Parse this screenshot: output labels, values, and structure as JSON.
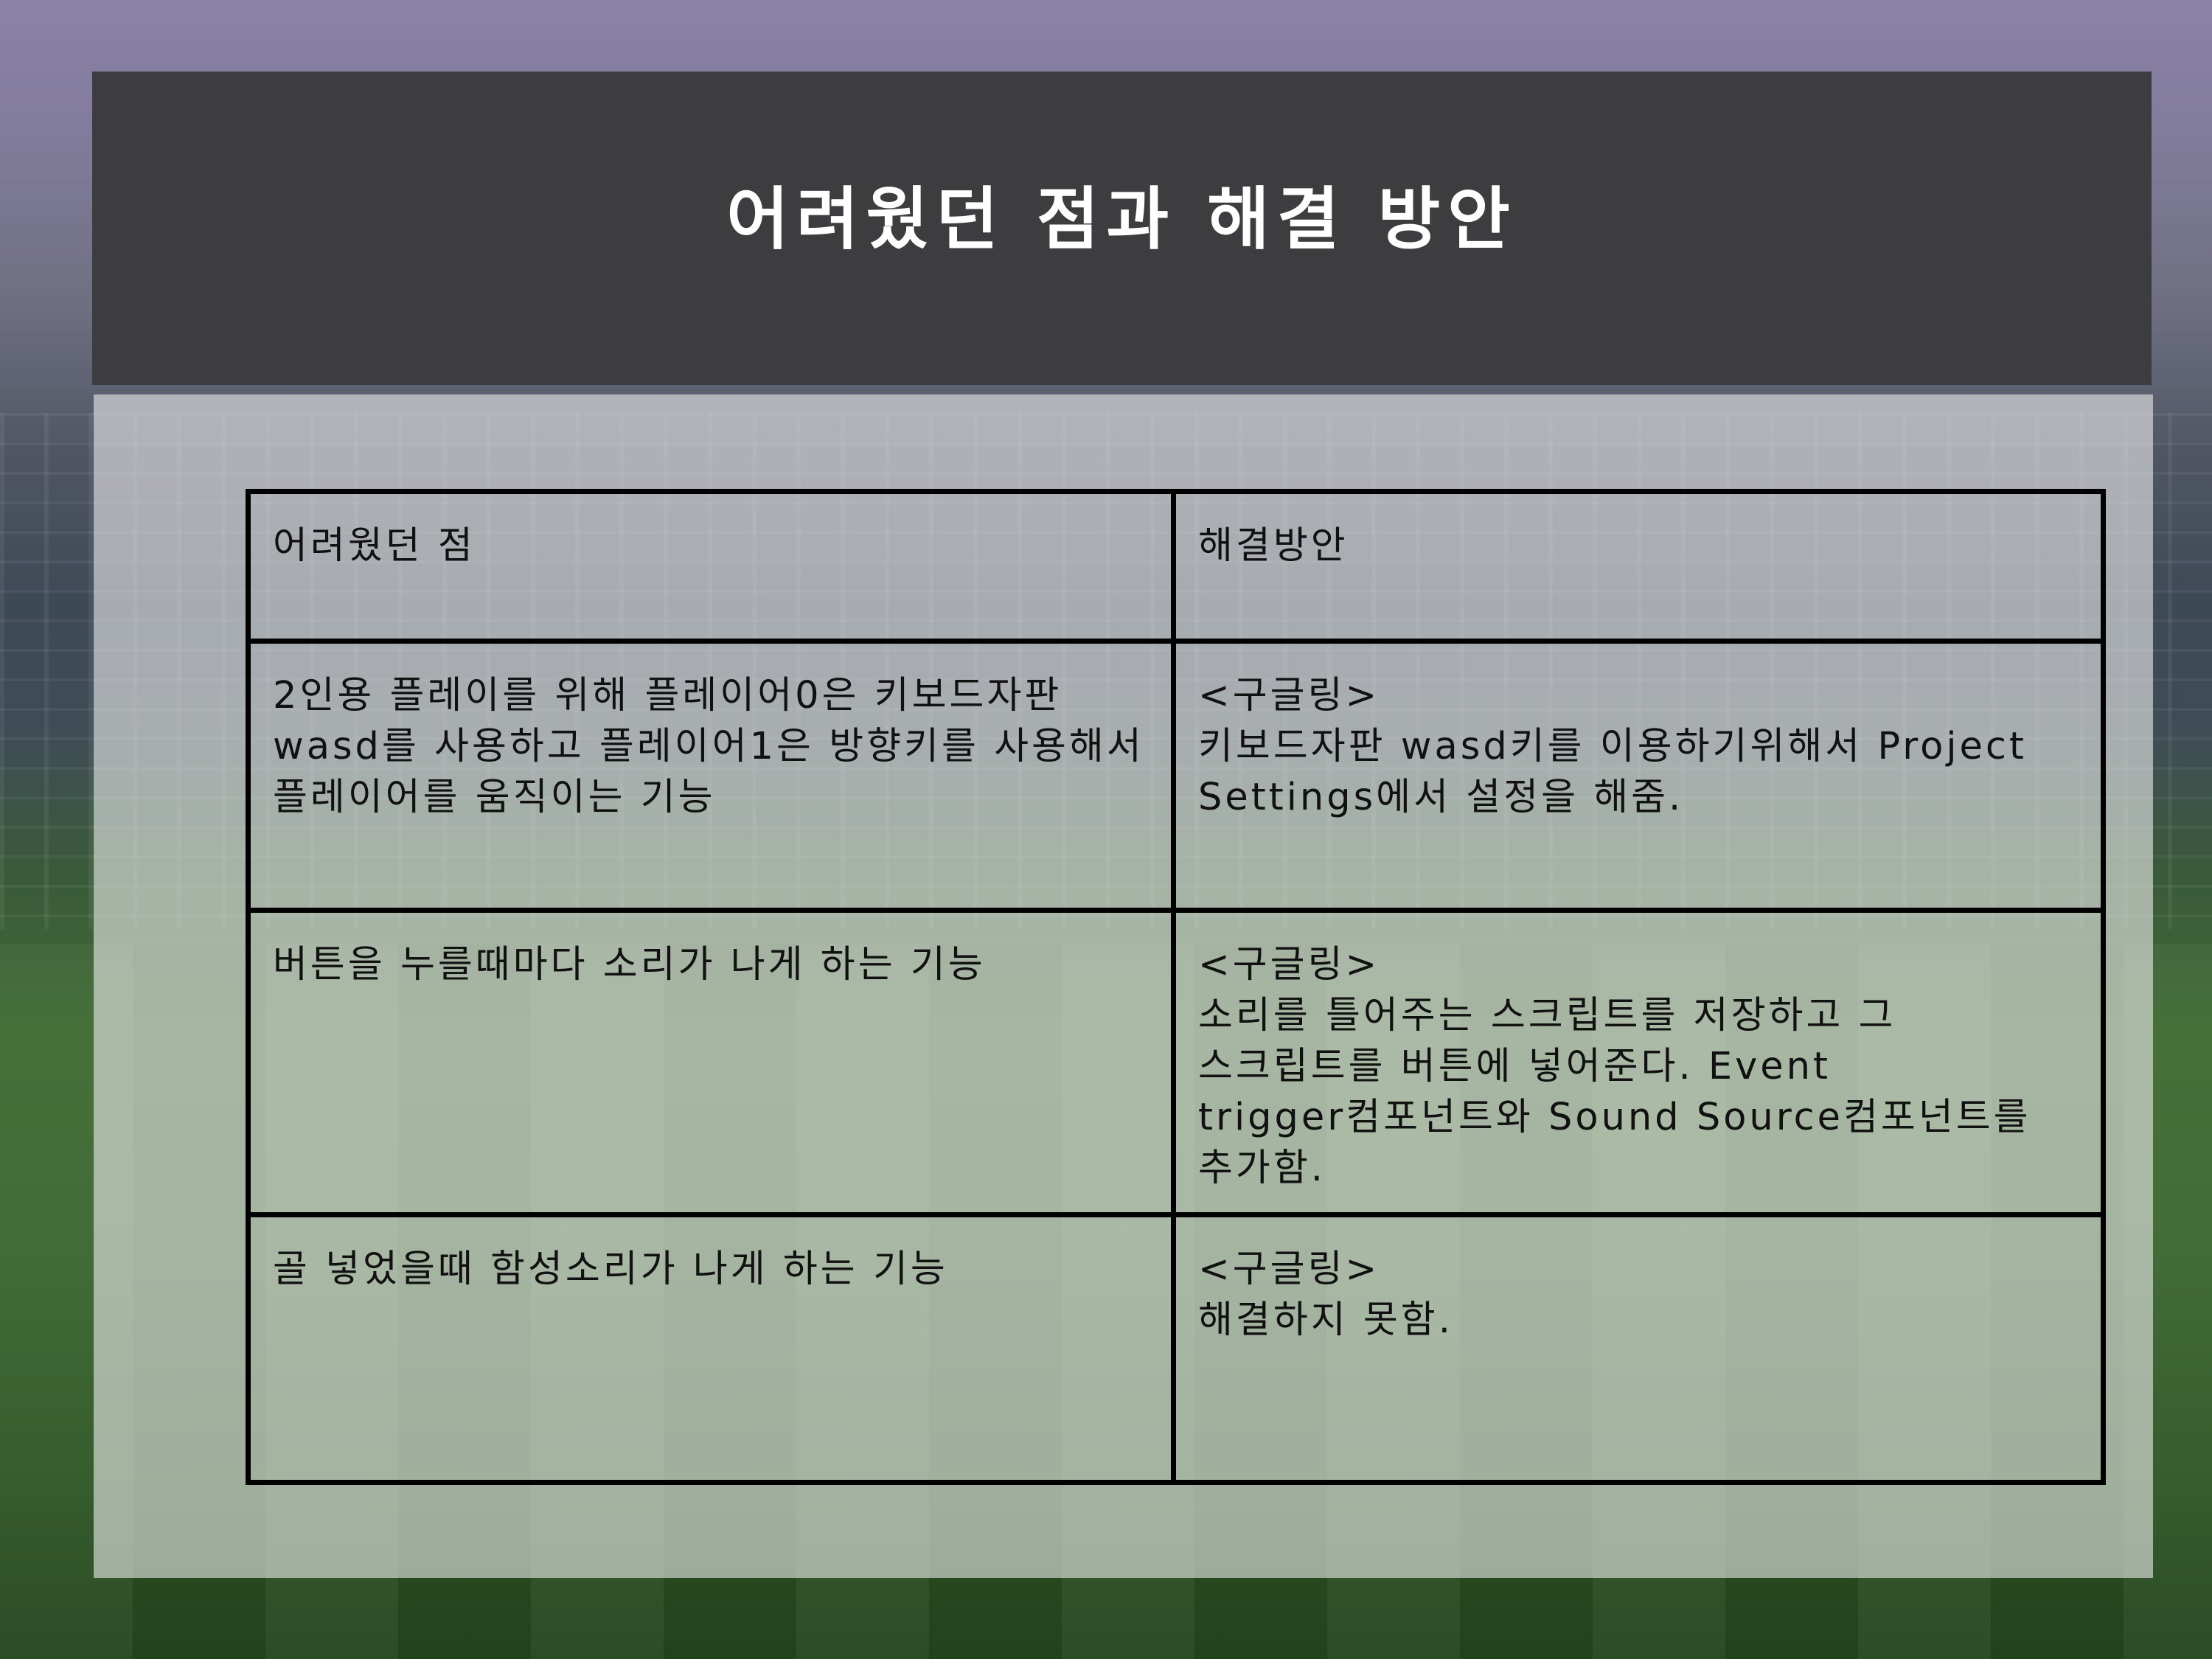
{
  "slide": {
    "title": "어려웠던 점과 해결 방안"
  },
  "table": {
    "headers": [
      "어려웠던 점",
      "해결방안"
    ],
    "rows": [
      {
        "difficulty": "2인용 플레이를 위해 플레이어0은 키보드자판 wasd를 사용하고 플레이어1은 방향키를 사용해서 플레이어를 움직이는 기능",
        "solution": "<구글링>\n키보드자판 wasd키를 이용하기위해서 Project Settings에서 설정을 해줌."
      },
      {
        "difficulty": "버튼을 누를때마다 소리가 나게 하는 기능",
        "solution": "<구글링>\n소리를 틀어주는 스크립트를 저장하고 그 스크립트를 버튼에 넣어준다. Event trigger컴포넌트와 Sound Source컴포넌트를 추가함."
      },
      {
        "difficulty": "골 넣었을때 함성소리가 나게 하는 기능",
        "solution": "<구글링>\n해결하지 못함."
      }
    ]
  }
}
